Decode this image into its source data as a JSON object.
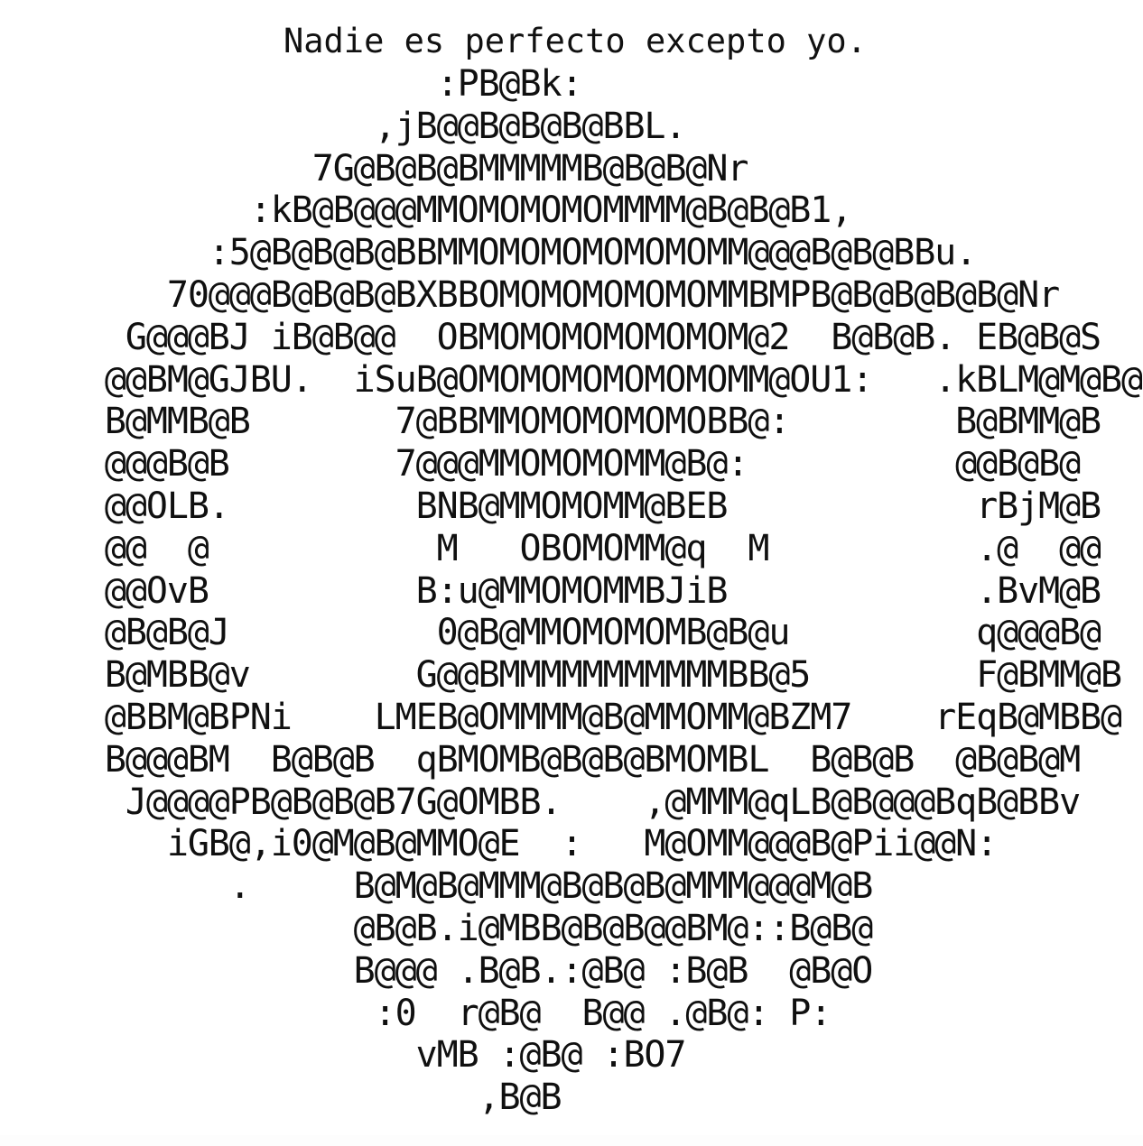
{
  "document": {
    "kind": "ascii-art-text",
    "background_color": "#ffffff",
    "text_color": "#101010",
    "headline": "Nadie es perfecto excepto yo.",
    "art_subject": "heart",
    "art_lines": [
      "                     :PB@Bk:",
      "                  ,jB@@B@B@B@BBL.",
      "               7G@B@B@BMMMMMB@B@B@Nr",
      "            :kB@B@@@MMOMOMOMOMMMM@B@B@B1,",
      "          :5@B@B@B@BBMMOMOMOMOMOMOMM@@@B@B@BBu.",
      "        70@@@B@B@B@BXBBOMOMOMOMOMOMMBMPB@B@B@B@B@Nr",
      "      G@@@BJ iB@B@@  OBMOMOMOMOMOMOM@2  B@B@B. EB@B@S",
      "     @@BM@GJBU.  iSuB@OMOMOMOMOMOMOMM@OU1:   .kBLM@M@B@",
      "     B@MMB@B       7@BBMMOMOMOMOMOBB@:        B@BMM@B",
      "     @@@B@B        7@@@MMOMOMOMM@B@:          @@B@B@",
      "     @@OLB.         BNB@MMOMOMM@BEB            rBjM@B",
      "     @@  @           M   OBOMOMM@q  M          .@  @@",
      "     @@OvB          B:u@MMOMOMMBJiB            .BvM@B",
      "     @B@B@J          0@B@MMOMOMOMB@B@u         q@@@B@",
      "     B@MBB@v        G@@BMMMMMMMMMMMBB@5        F@BMM@B",
      "     @BBM@BPNi    LMEB@OMMMM@B@MMOMM@BZM7    rEqB@MBB@",
      "     B@@@BM  B@B@B  qBMOMB@B@B@BMOMBL  B@B@B  @B@B@M",
      "      J@@@@PB@B@B@B7G@OMBB.    ,@MMM@qLB@B@@@BqB@BBv",
      "        iGB@,i0@M@B@MMO@E  :   M@OMM@@@B@Pii@@N:",
      "           .     B@M@B@MMM@B@B@B@MMM@@@M@B",
      "                 @B@B.i@MBB@B@B@@BM@::B@B@",
      "                 B@@@ .B@B.:@B@ :B@B  @B@O",
      "                  :0  r@B@  B@@ .@B@: P:",
      "                    vMB :@B@ :BO7",
      "                       ,B@B"
    ]
  }
}
